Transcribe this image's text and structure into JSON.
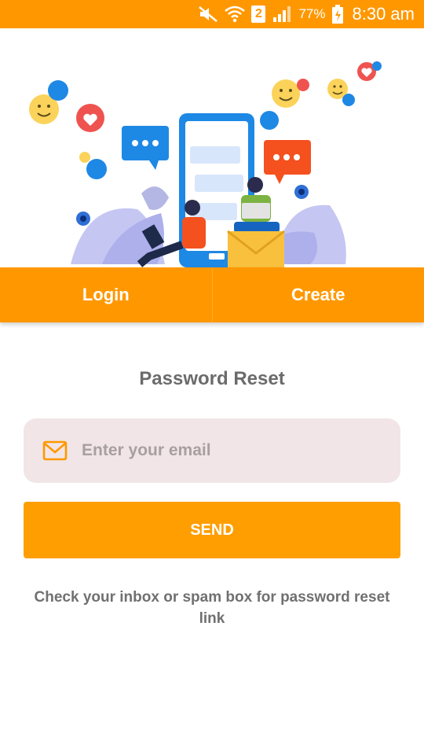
{
  "status_bar": {
    "sim_slot": "2",
    "battery": "77%",
    "time": "8:30 am"
  },
  "tabs": {
    "login_label": "Login",
    "create_label": "Create"
  },
  "form": {
    "title": "Password Reset",
    "email_placeholder": "Enter your email",
    "email_value": "",
    "send_label": "SEND",
    "help_text": "Check your inbox or spam box for password reset link"
  },
  "colors": {
    "accent": "#ff9800",
    "field_background": "#f1e5e7",
    "title_text": "#6b6b6b"
  }
}
